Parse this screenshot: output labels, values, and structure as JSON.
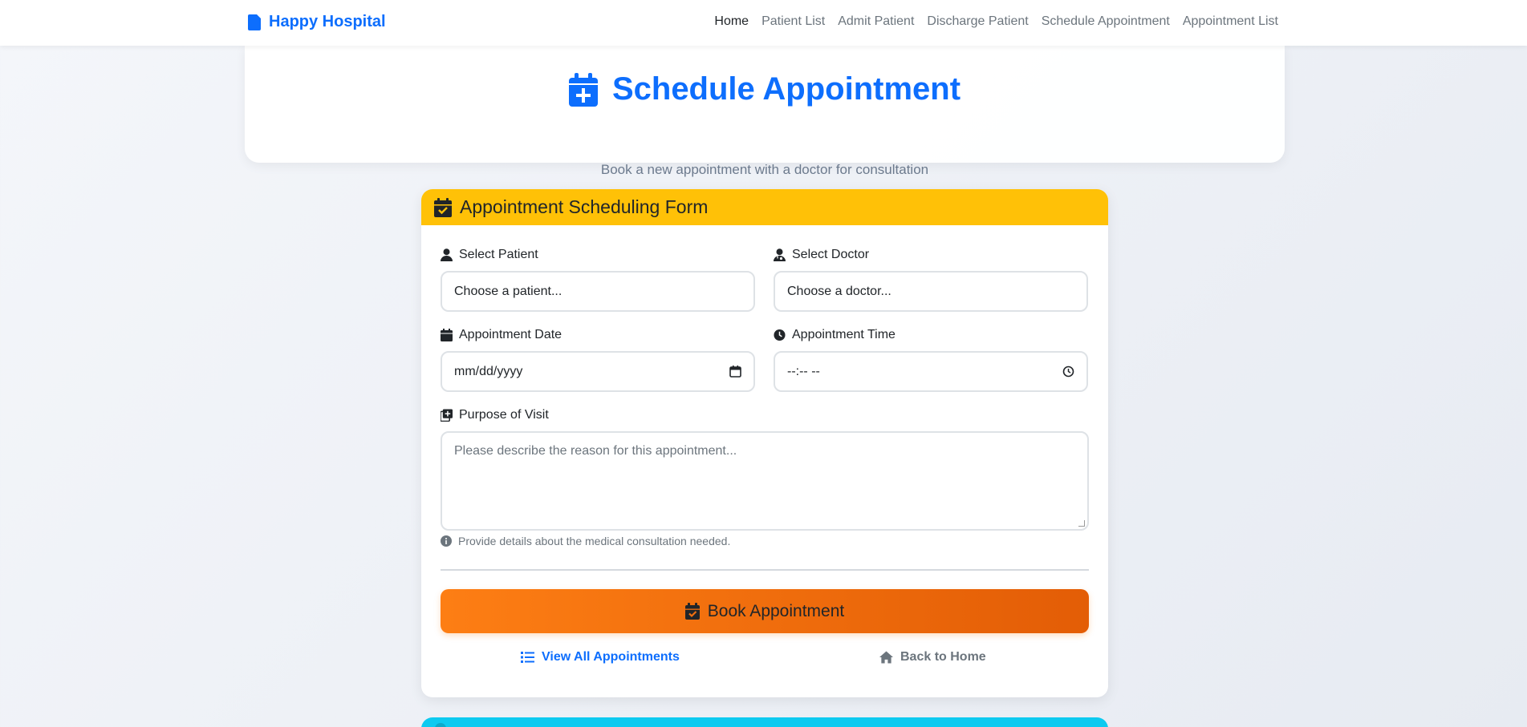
{
  "navbar": {
    "brand": "Happy Hospital",
    "links": [
      "Home",
      "Patient List",
      "Admit Patient",
      "Discharge Patient",
      "Schedule Appointment",
      "Appointment List"
    ]
  },
  "hero": {
    "title": "Schedule Appointment",
    "subtitle": "Book a new appointment with a doctor for consultation"
  },
  "form": {
    "header": "Appointment Scheduling Form",
    "patient": {
      "label": "Select Patient",
      "value": "Choose a patient..."
    },
    "doctor": {
      "label": "Select Doctor",
      "value": "Choose a doctor..."
    },
    "date": {
      "label": "Appointment Date",
      "value": "mm/dd/yyyy"
    },
    "time": {
      "label": "Appointment Time",
      "value": "--:-- --"
    },
    "purpose": {
      "label": "Purpose of Visit",
      "placeholder": "Please describe the reason for this appointment...",
      "help": "Provide details about the medical consultation needed."
    },
    "submit": "Book Appointment",
    "view_all": "View All Appointments",
    "back_home": "Back to Home"
  },
  "colors": {
    "brand": "#0d6efd",
    "form_header": "#ffc107",
    "submit_start": "#fd7e14",
    "submit_end": "#e35d06",
    "next_card": "#0dcaf0"
  }
}
